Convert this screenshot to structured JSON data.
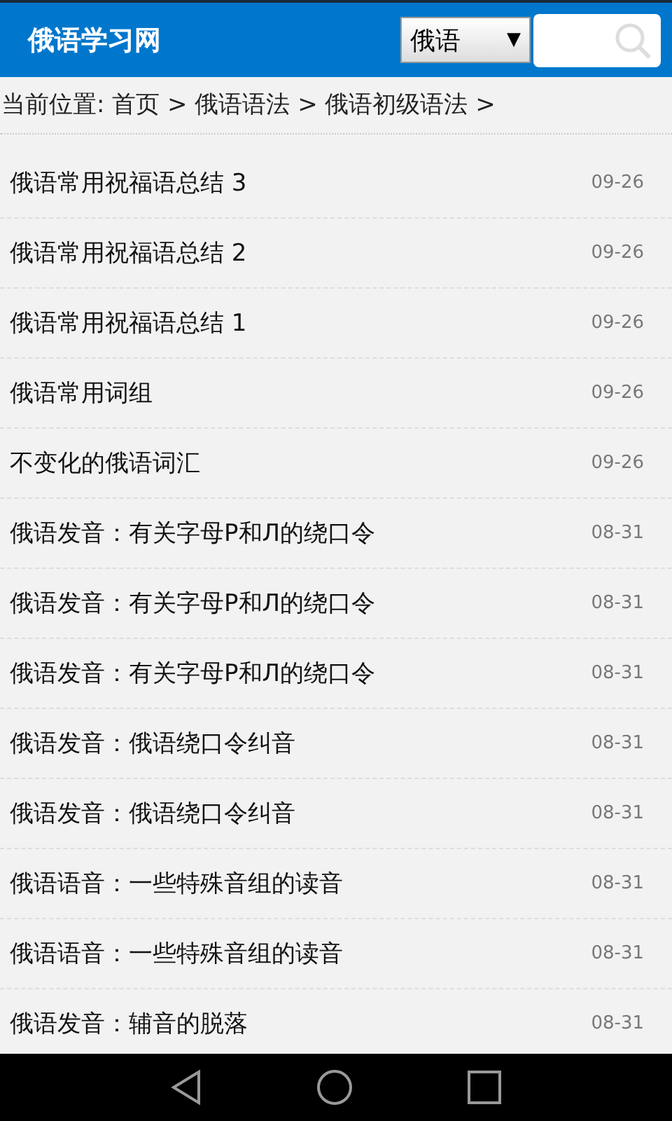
{
  "header": {
    "title": "俄语学习网",
    "language_select": "俄语",
    "language_caret": "▼"
  },
  "breadcrumb": "当前位置: 首页 > 俄语语法 > 俄语初级语法 >",
  "articles": [
    {
      "title": "俄语常用祝福语总结 3",
      "date": "09-26"
    },
    {
      "title": "俄语常用祝福语总结 2",
      "date": "09-26"
    },
    {
      "title": "俄语常用祝福语总结 1",
      "date": "09-26"
    },
    {
      "title": "俄语常用词组",
      "date": "09-26"
    },
    {
      "title": "不变化的俄语词汇",
      "date": "09-26"
    },
    {
      "title": "俄语发音：有关字母P和Л的绕口令",
      "date": "08-31"
    },
    {
      "title": "俄语发音：有关字母P和Л的绕口令",
      "date": "08-31"
    },
    {
      "title": "俄语发音：有关字母P和Л的绕口令",
      "date": "08-31"
    },
    {
      "title": "俄语发音：俄语绕口令纠音",
      "date": "08-31"
    },
    {
      "title": "俄语发音：俄语绕口令纠音",
      "date": "08-31"
    },
    {
      "title": "俄语语音：一些特殊音组的读音",
      "date": "08-31"
    },
    {
      "title": "俄语语音：一些特殊音组的读音",
      "date": "08-31"
    },
    {
      "title": "俄语发音：辅音的脱落",
      "date": "08-31"
    }
  ]
}
